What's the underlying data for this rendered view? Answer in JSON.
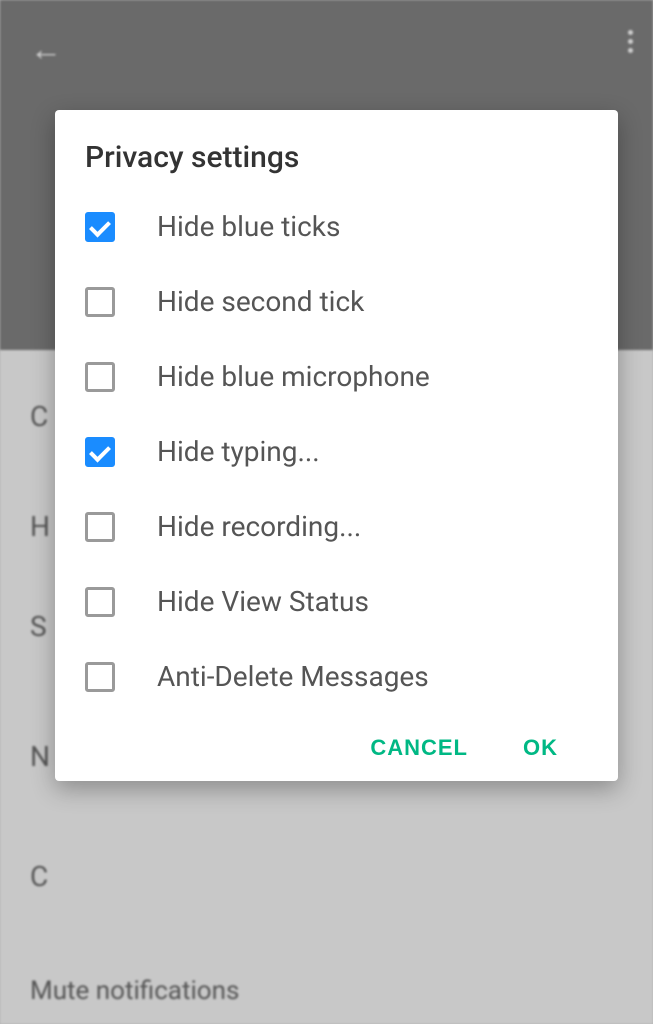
{
  "dialog": {
    "title": "Privacy settings",
    "options": [
      {
        "label": "Hide blue ticks",
        "checked": true
      },
      {
        "label": "Hide second tick",
        "checked": false
      },
      {
        "label": "Hide blue microphone",
        "checked": false
      },
      {
        "label": "Hide typing...",
        "checked": true
      },
      {
        "label": "Hide recording...",
        "checked": false
      },
      {
        "label": "Hide View Status",
        "checked": false
      },
      {
        "label": "Anti-Delete Messages",
        "checked": false
      }
    ],
    "cancel_label": "CANCEL",
    "ok_label": "OK"
  },
  "background": {
    "mute_label": "Mute notifications"
  }
}
